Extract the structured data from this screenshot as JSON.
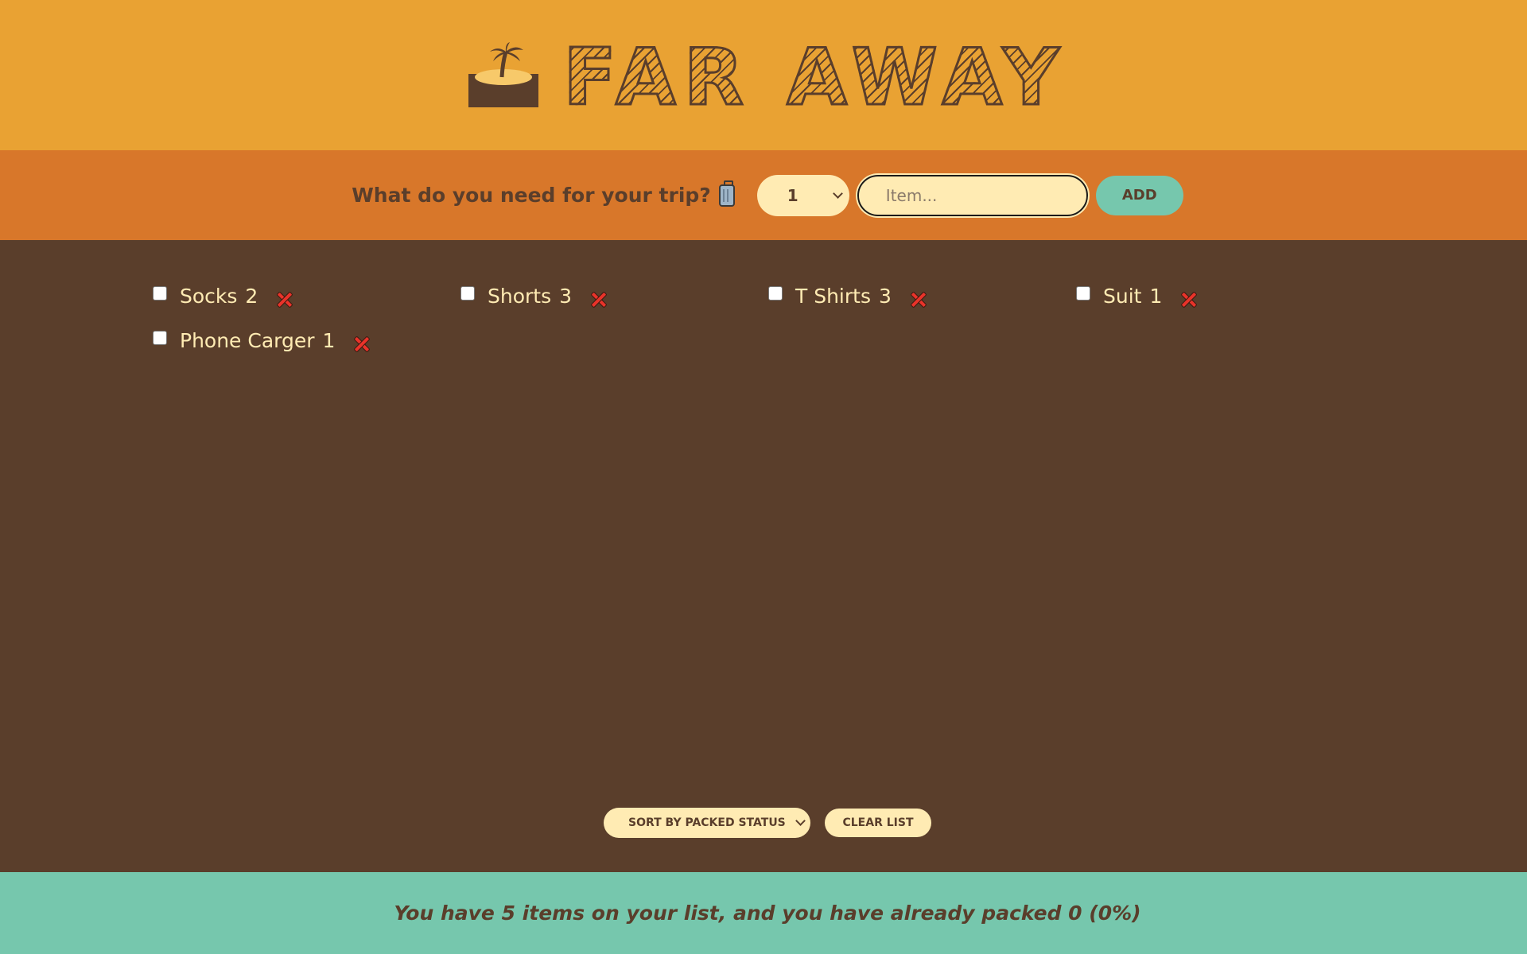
{
  "header": {
    "title": "Far Away",
    "logo_icon": "island-palm-icon"
  },
  "form": {
    "label": "What do you need for your trip?",
    "label_icon": "suitcase-icon",
    "quantity_value": "1",
    "item_placeholder": "Item...",
    "add_label": "Add"
  },
  "items": [
    {
      "description": "Socks",
      "quantity": "2",
      "packed": false
    },
    {
      "description": "Shorts",
      "quantity": "3",
      "packed": false
    },
    {
      "description": "T Shirts",
      "quantity": "3",
      "packed": false
    },
    {
      "description": "Suit",
      "quantity": "1",
      "packed": false
    },
    {
      "description": "Phone Carger",
      "quantity": "1",
      "packed": false
    }
  ],
  "actions": {
    "sort_value": "Sort by packed status",
    "clear_label": "Clear list"
  },
  "stats": {
    "text": "You have 5 items on your list, and you have already packed 0 (0%)"
  },
  "colors": {
    "header_bg": "#e9a233",
    "form_bg": "#d8772a",
    "list_bg": "#5a3e2b",
    "stats_bg": "#76c7ad",
    "cream": "#ffebb3",
    "delete_red": "#e8332a"
  }
}
